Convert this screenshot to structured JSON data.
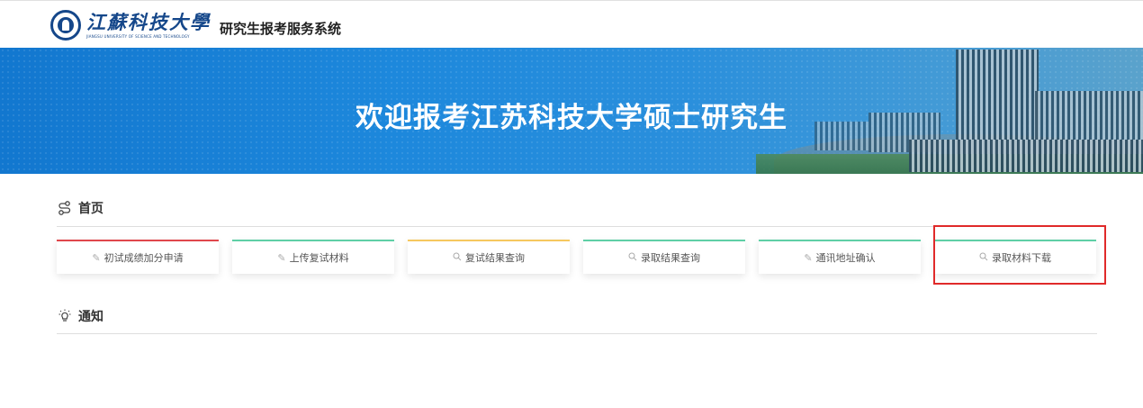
{
  "header": {
    "university_cn": "江蘇科技大學",
    "university_en": "JIANGSU UNIVERSITY OF SCIENCE AND TECHNOLOGY",
    "system_title": "研究生报考服务系统"
  },
  "banner": {
    "title": "欢迎报考江苏科技大学硕士研究生"
  },
  "home": {
    "title": "首页",
    "icon": "route-icon",
    "cards": [
      {
        "label": "初试成绩加分申请",
        "icon": "pencil-icon",
        "accent": "#e0474c"
      },
      {
        "label": "上传复试材料",
        "icon": "pencil-icon",
        "accent": "#5fcfa6"
      },
      {
        "label": "复试结果查询",
        "icon": "search-icon",
        "accent": "#f6c85f"
      },
      {
        "label": "录取结果查询",
        "icon": "search-icon",
        "accent": "#5fcfa6"
      },
      {
        "label": "通讯地址确认",
        "icon": "pencil-icon",
        "accent": "#5fcfa6"
      },
      {
        "label": "录取材料下载",
        "icon": "search-icon",
        "accent": "#5fcfa6"
      }
    ]
  },
  "notice": {
    "title": "通知",
    "icon": "lightbulb-icon"
  },
  "highlight_color": "#e02a2a"
}
